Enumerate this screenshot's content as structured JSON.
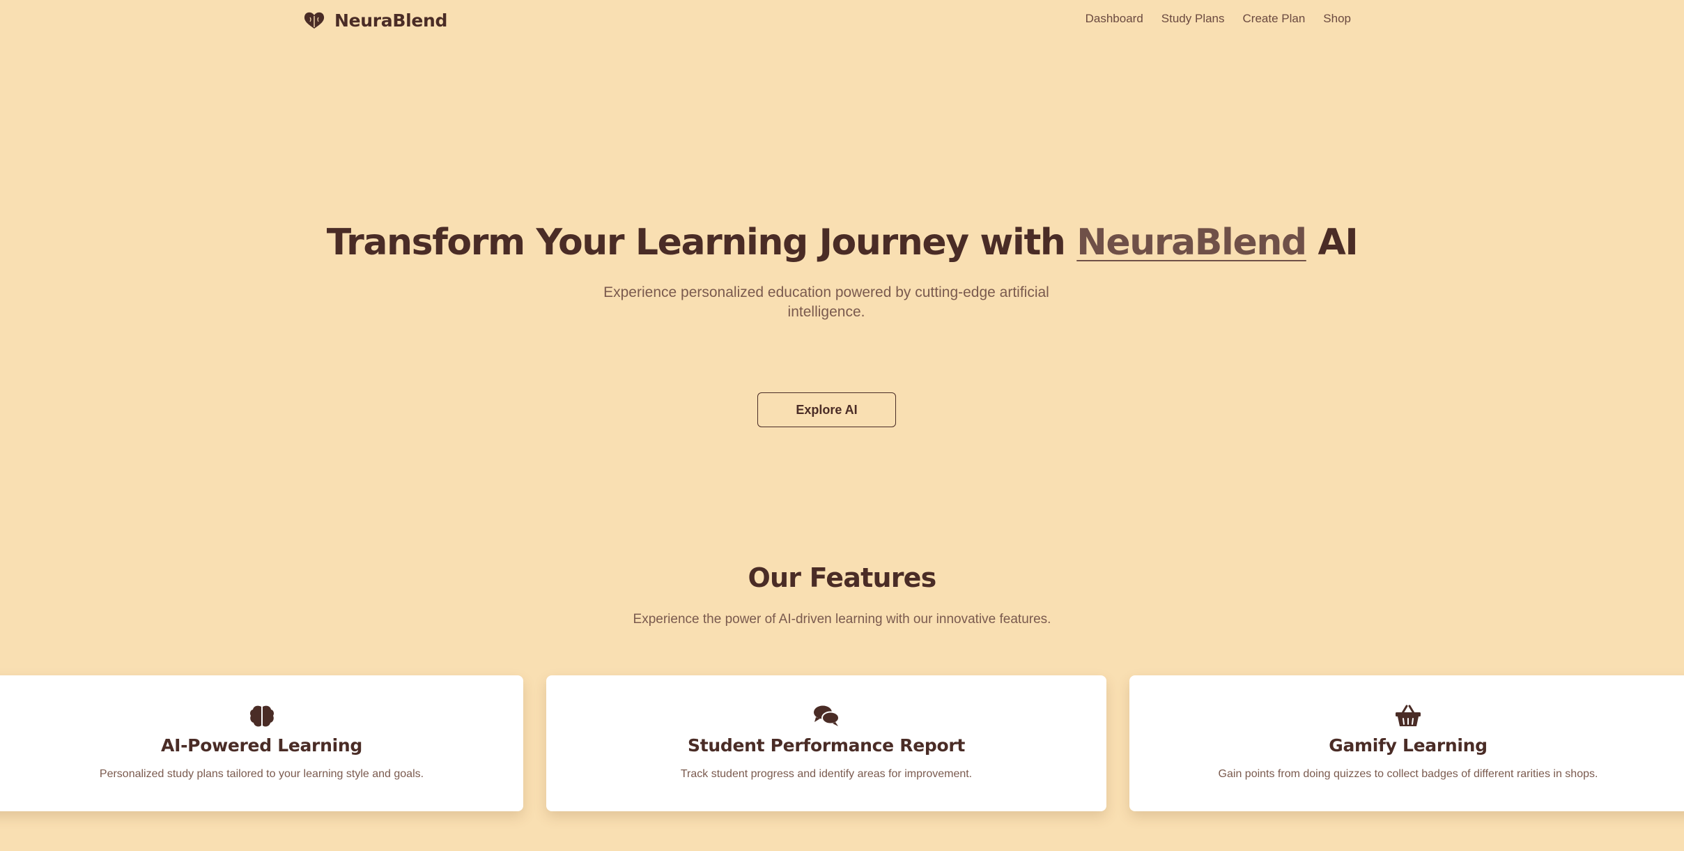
{
  "nav": {
    "brand": "NeuraBlend",
    "logo_icon": "heart-brain-icon",
    "links": [
      "Dashboard",
      "Study Plans",
      "Create Plan",
      "Shop"
    ]
  },
  "hero": {
    "title_before": "Transform Your Learning Journey with ",
    "title_highlight": "NeuraBlend",
    "title_after": " AI",
    "subtitle": "Experience personalized education powered by cutting-edge artificial intelligence.",
    "cta_label": "Explore AI"
  },
  "features": {
    "title": "Our Features",
    "subtitle": "Experience the power of AI-driven learning with our innovative features.",
    "cards": [
      {
        "icon": "brain-icon",
        "title": "AI-Powered Learning",
        "description": "Personalized study plans tailored to your learning style and goals."
      },
      {
        "icon": "comments-icon",
        "title": "Student Performance Report",
        "description": "Track student progress and identify areas for improvement."
      },
      {
        "icon": "basket-icon",
        "title": "Gamify Learning",
        "description": "Gain points from doing quizzes to collect badges of different rarities in shops."
      }
    ]
  },
  "colors": {
    "background": "#f9dfb2",
    "text_dark": "#4a2c26",
    "text_muted": "#7a5a4e",
    "card_bg": "#ffffff"
  }
}
